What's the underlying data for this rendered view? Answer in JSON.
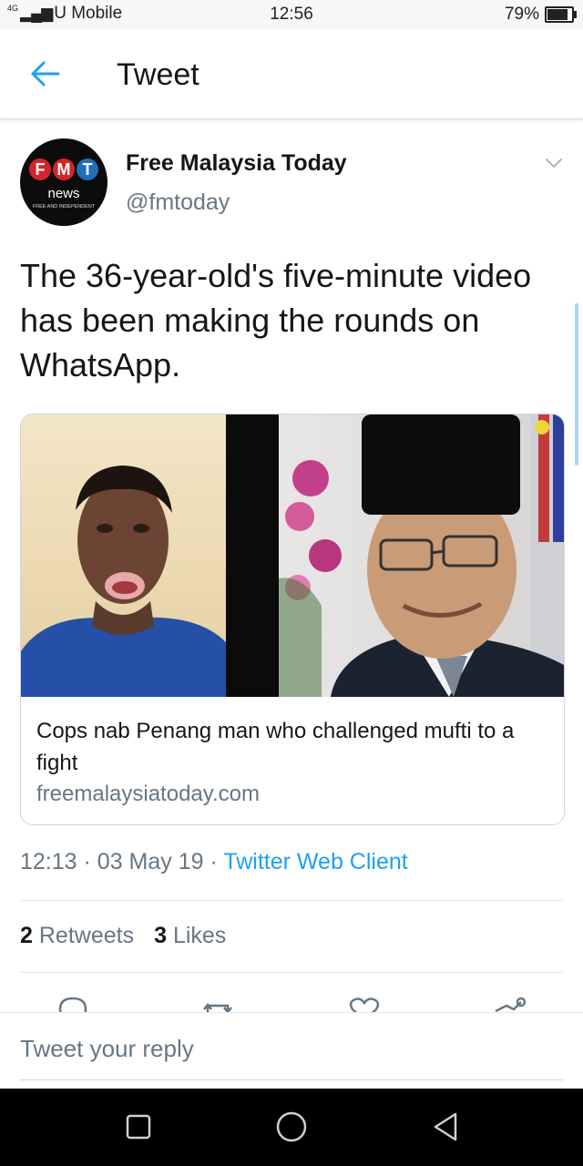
{
  "status_bar": {
    "network": "4G",
    "carrier": "U Mobile",
    "time": "12:56",
    "battery": "79%",
    "battery_level": 0.79
  },
  "app_bar": {
    "title": "Tweet",
    "back_icon": "arrow-left-icon"
  },
  "tweet": {
    "avatar": {
      "logo_letters": [
        "F",
        "M",
        "T"
      ],
      "logo_word": "news",
      "logo_tagline": "FREE AND INDEPENDENT"
    },
    "author_name": "Free Malaysia Today",
    "author_handle": "@fmtoday",
    "text": "The 36-year-old's five-minute video has been making the rounds on WhatsApp.",
    "card": {
      "title": "Cops nab Penang man who challenged mufti to a fight",
      "domain": "freemalaysiatoday.com"
    },
    "time": "12:13",
    "date": "03 May 19",
    "separator": "·",
    "client": "Twitter Web Client",
    "retweets_count": "2",
    "retweets_label": "Retweets",
    "likes_count": "3",
    "likes_label": "Likes"
  },
  "reply": {
    "placeholder": "Tweet your reply"
  },
  "colors": {
    "link_blue": "#1da1f2",
    "secondary_text": "#657786",
    "primary_text": "#14171a",
    "logo_red": "#d2262b",
    "logo_blue": "#1f6fb7"
  },
  "icons": [
    "arrow-left-icon",
    "chevron-down-icon",
    "reply-icon",
    "retweet-icon",
    "like-icon",
    "share-icon",
    "recents-icon",
    "home-icon",
    "back-triangle-icon"
  ]
}
